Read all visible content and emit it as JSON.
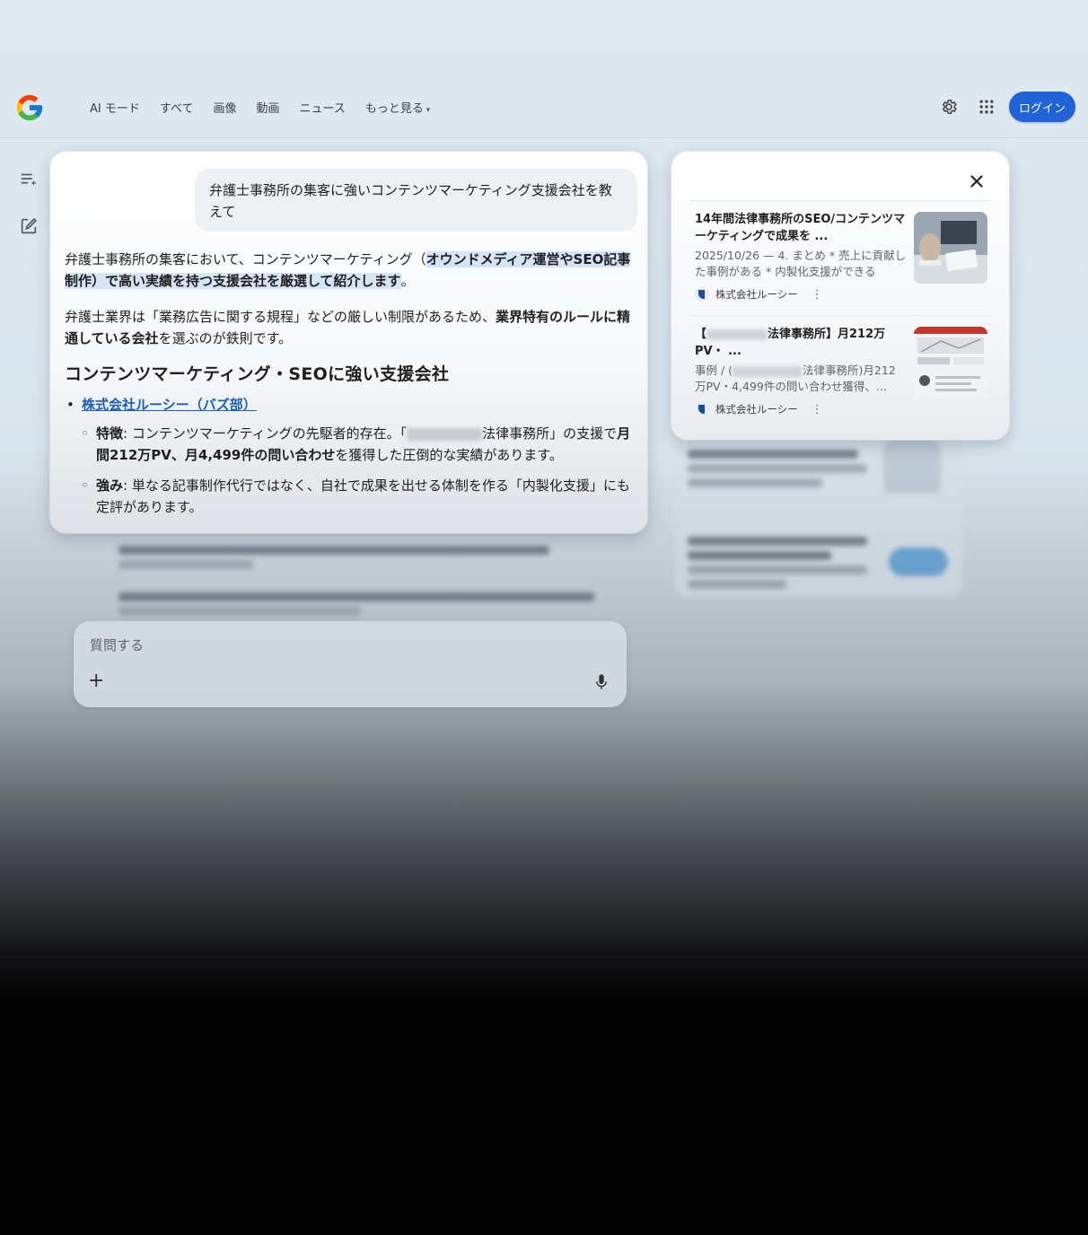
{
  "header": {
    "nav": [
      "AI モード",
      "すべて",
      "画像",
      "動画",
      "ニュース",
      "もっと見る"
    ],
    "login_label": "ログイン"
  },
  "query": "弁護士事務所の集客に強いコンテンツマーケティング支援会社を教えて",
  "answer": {
    "p1_pre": "弁護士事務所の集客において、コンテンツマーケティング（",
    "p1_bold": "オウンドメディア運営やSEO記事制作）で高い実績を持つ支援会社を厳選して紹介します",
    "p1_post": "。",
    "p2_pre": "弁護士業界は「業務広告に関する規程」などの厳しい制限があるため、",
    "p2_bold": "業界特有のルールに精通している会社",
    "p2_post": "を選ぶのが鉄則です。",
    "heading": "コンテンツマーケティング・SEOに強い支援会社",
    "company_link": "株式会社ルーシー（バズ部）",
    "feature_label": "特徴",
    "feature_pre": ": コンテンツマーケティングの先駆者的存在。「",
    "feature_mid": "法律事務所」の支援で",
    "feature_bold": "月間212万PV、月4,499件の問い合わせ",
    "feature_post": "を獲得した圧倒的な実績があります。",
    "strength_label": "強み",
    "strength_text": ": 単なる記事制作代行ではなく、自社で成果を出せる体制を作る「内製化支援」にも定評があります。"
  },
  "sources": [
    {
      "title": "14年間法律事務所のSEO/コンテンツマーケティングで成果を ...",
      "desc": "2025/10/26 — 4. まとめ * 売上に貢献した事例がある * 内製化支援ができる",
      "site": "株式会社ルーシー"
    },
    {
      "title_pre": "【",
      "title_post": "法律事務所】月212万PV・ ...",
      "desc_pre": "事例 / (",
      "desc_post": "法律事務所)月212万PV・4,499件の問い合わせ獲得、...",
      "site": "株式会社ルーシー"
    }
  ],
  "ask": {
    "placeholder": "質問する",
    "plus": "+"
  },
  "colors": {
    "accent": "#1f63d6",
    "link": "#1a5fb4",
    "highlight": "#d6e4f7"
  }
}
